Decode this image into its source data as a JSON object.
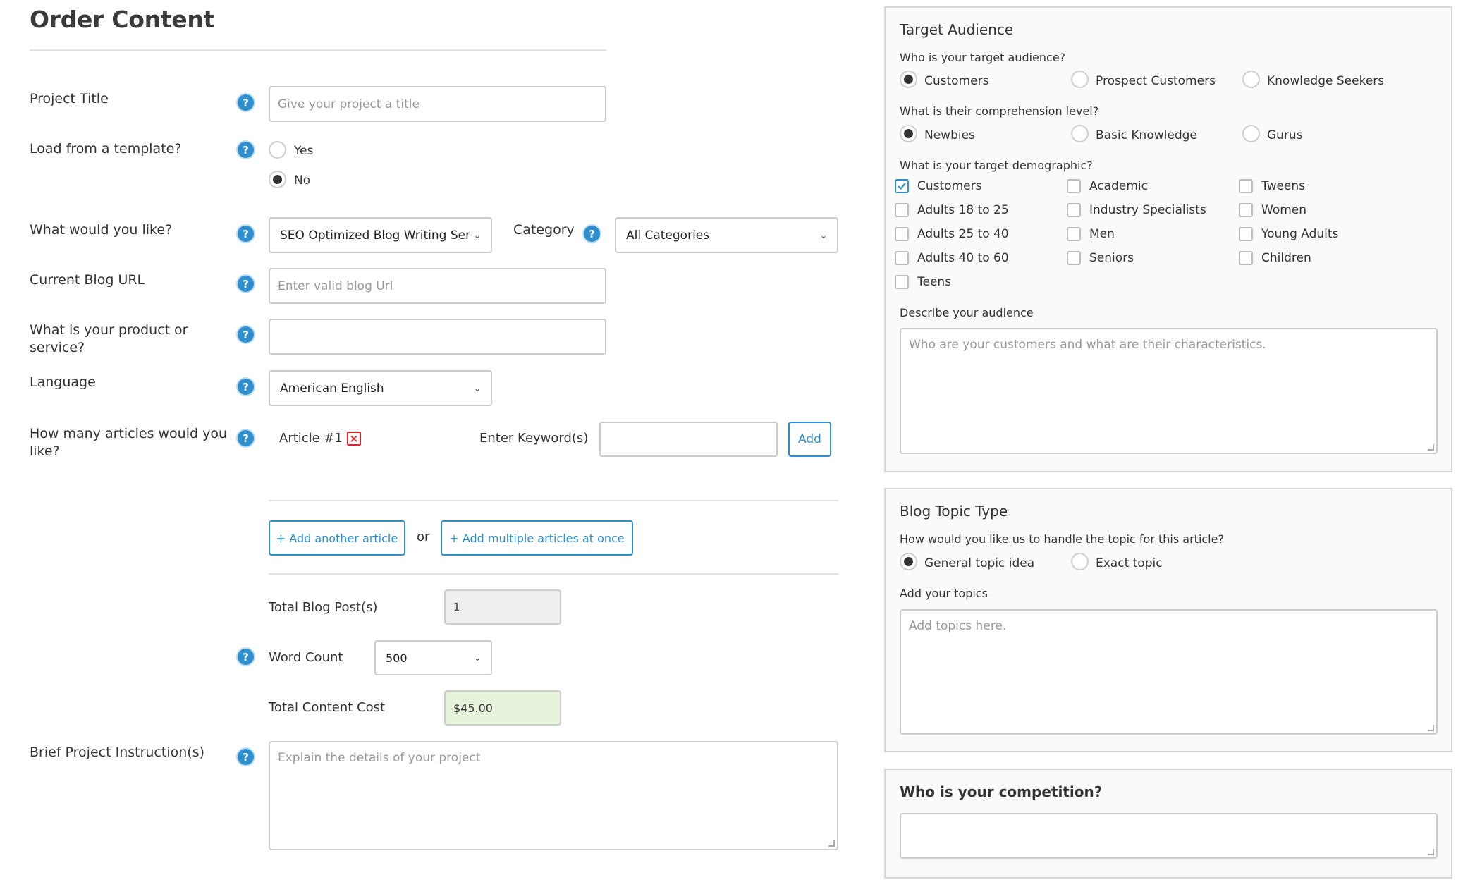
{
  "page_title": "Order Content",
  "form": {
    "project_title": {
      "label": "Project Title",
      "placeholder": "Give your project a title"
    },
    "template": {
      "label": "Load from a template?",
      "options": [
        "Yes",
        "No"
      ],
      "selected": "No"
    },
    "service": {
      "label": "What would you like?",
      "selected": "SEO Optimized Blog Writing Servic"
    },
    "category": {
      "label": "Category",
      "selected": "All Categories"
    },
    "blog_url": {
      "label": "Current Blog URL",
      "placeholder": "Enter valid blog Url"
    },
    "product": {
      "label_line1": "What is your product or",
      "label_line2": "service?"
    },
    "language": {
      "label": "Language",
      "selected": "American English"
    },
    "articles": {
      "label_line1": "How many articles would you",
      "label_line2": "like?",
      "article_label": "Article #1",
      "keyword_label": "Enter Keyword(s)",
      "add_label": "Add",
      "add_another": "+ Add another article",
      "or_text": "or",
      "add_multiple": "+ Add multiple articles at once"
    },
    "totals": {
      "blog_posts_label": "Total Blog Post(s)",
      "blog_posts_value": "1",
      "word_count_label": "Word Count",
      "word_count_value": "500",
      "cost_label": "Total Content Cost",
      "cost_value": "$45.00"
    },
    "instructions": {
      "label": "Brief Project Instruction(s)",
      "placeholder": "Explain the details of your project"
    },
    "help_glyph": "?"
  },
  "target_audience": {
    "title": "Target Audience",
    "audience_q": "Who is your target audience?",
    "audience_options": [
      "Customers",
      "Prospect Customers",
      "Knowledge Seekers"
    ],
    "audience_selected": "Customers",
    "level_q": "What is their comprehension level?",
    "level_options": [
      "Newbies",
      "Basic Knowledge",
      "Gurus"
    ],
    "level_selected": "Newbies",
    "demo_q": "What is your target demographic?",
    "demographics": [
      "Customers",
      "Academic",
      "Tweens",
      "Adults 18 to 25",
      "Industry Specialists",
      "Women",
      "Adults 25 to 40",
      "Men",
      "Young Adults",
      "Adults 40 to 60",
      "Seniors",
      "Children",
      "Teens"
    ],
    "demographics_checked": [
      "Customers"
    ],
    "describe_label": "Describe your audience",
    "describe_placeholder": "Who are your customers and what are their characteristics."
  },
  "blog_topic": {
    "title": "Blog Topic Type",
    "question": "How would you like us to handle the topic for this article?",
    "options": [
      "General topic idea",
      "Exact topic"
    ],
    "selected": "General topic idea",
    "topics_label": "Add your topics",
    "topics_placeholder": "Add topics here."
  },
  "competition": {
    "title": "Who is your competition?"
  },
  "colors": {
    "accent": "#2f8fce",
    "danger": "#d9262c",
    "cost_bg": "#e8f3dc",
    "readonly_bg": "#eeeeee"
  }
}
